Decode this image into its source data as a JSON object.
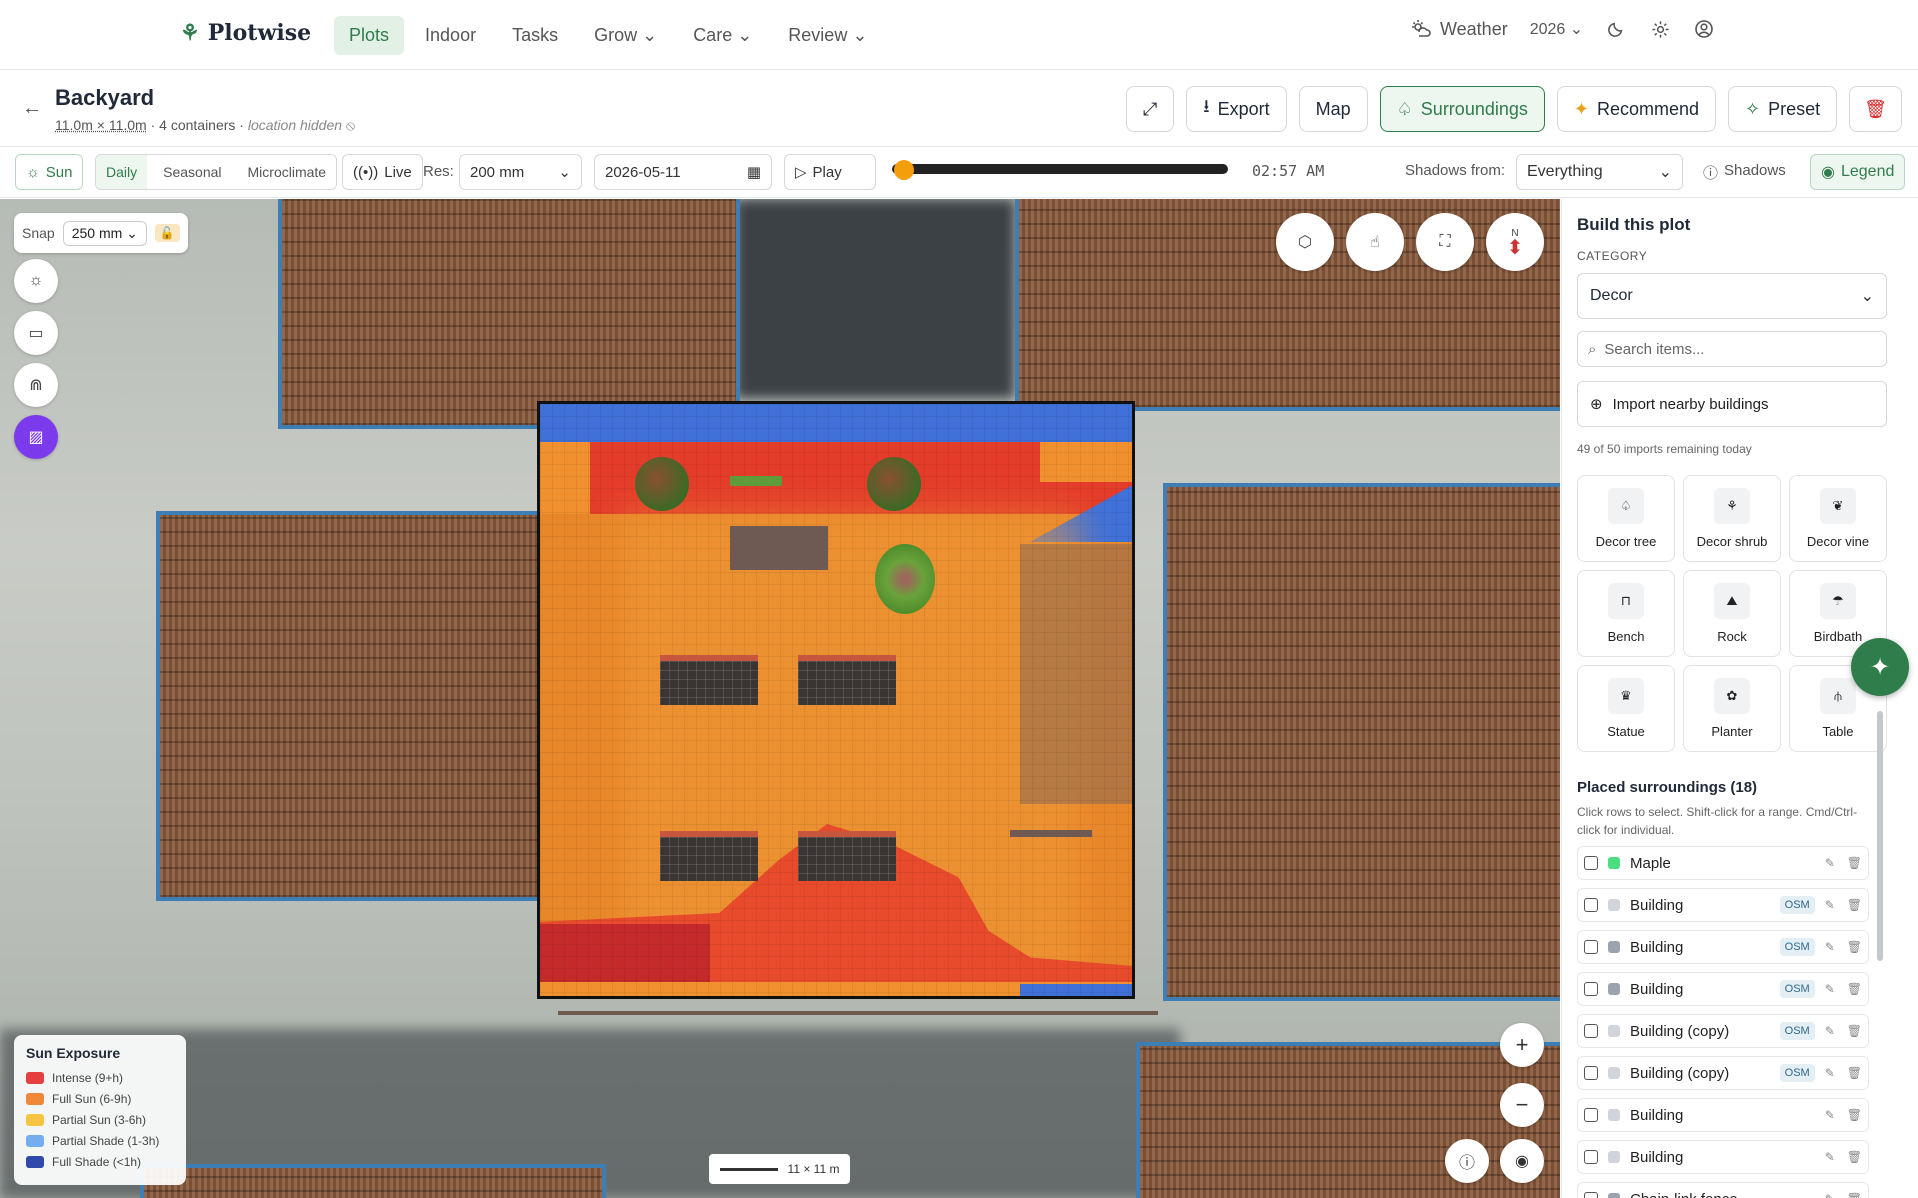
{
  "nav": {
    "brand": "Plotwise",
    "items": [
      {
        "label": "Plots",
        "active": true
      },
      {
        "label": "Indoor",
        "active": false
      },
      {
        "label": "Tasks",
        "active": false
      },
      {
        "label": "Grow ⌄",
        "active": false
      },
      {
        "label": "Care ⌄",
        "active": false
      },
      {
        "label": "Review ⌄",
        "active": false
      }
    ],
    "weather": "Weather",
    "year": "2026 ⌄"
  },
  "header": {
    "title": "Backyard",
    "dimensions": "11.0m × 11.0m",
    "containers": " · 4 containers · ",
    "location": "location hidden",
    "buttons": {
      "export": "Export",
      "map": "Map",
      "surroundings": "Surroundings",
      "recommend": "Recommend",
      "preset": "Preset"
    }
  },
  "toolbar": {
    "sun": "Sun",
    "modes": [
      "Daily",
      "Seasonal",
      "Microclimate"
    ],
    "active_mode": "Daily",
    "live": "Live",
    "res_label": "Res:",
    "res_value": "200 mm",
    "date": "2026-05-11",
    "play": "Play",
    "time": "02:57 AM",
    "time_progress": 0.02,
    "shadows_from_label": "Shadows from:",
    "shadows_from_value": "Everything",
    "shadows": "Shadows",
    "legend": "Legend"
  },
  "canvas": {
    "snap_label": "Snap",
    "snap_value": "250 mm",
    "compass": "N",
    "scale": "11 × 11 m",
    "legend": {
      "title": "Sun Exposure",
      "items": [
        {
          "label": "Intense (9+h)",
          "color": "#e53e3e"
        },
        {
          "label": "Full Sun (6-9h)",
          "color": "#f0883a"
        },
        {
          "label": "Partial Sun (3-6h)",
          "color": "#f5c542"
        },
        {
          "label": "Partial Shade (1-3h)",
          "color": "#74aef0"
        },
        {
          "label": "Full Shade (<1h)",
          "color": "#2f4aa8"
        }
      ]
    }
  },
  "panel": {
    "title": "Build this plot",
    "category_label": "CATEGORY",
    "category_value": "Decor",
    "search_placeholder": "Search items...",
    "import": "Import nearby buildings",
    "remaining": "49 of 50 imports remaining today",
    "tiles": [
      {
        "label": "Decor tree",
        "icon": "tree-icon"
      },
      {
        "label": "Decor shrub",
        "icon": "shrub-icon"
      },
      {
        "label": "Decor vine",
        "icon": "vine-icon"
      },
      {
        "label": "Bench",
        "icon": "bench-icon"
      },
      {
        "label": "Rock",
        "icon": "rock-icon"
      },
      {
        "label": "Birdbath",
        "icon": "birdbath-icon"
      },
      {
        "label": "Statue",
        "icon": "statue-icon"
      },
      {
        "label": "Planter",
        "icon": "planter-icon"
      },
      {
        "label": "Table",
        "icon": "table-icon"
      }
    ],
    "placed_title": "Placed surroundings (18)",
    "placed_help": "Click rows to select. Shift-click for a range. Cmd/Ctrl-click for individual.",
    "placed": [
      {
        "name": "Maple",
        "color": "#4ade80",
        "osm": ""
      },
      {
        "name": "Building",
        "color": "#d1d5db",
        "osm": "OSM"
      },
      {
        "name": "Building",
        "color": "#9ca3af",
        "osm": "OSM"
      },
      {
        "name": "Building",
        "color": "#9ca3af",
        "osm": "OSM"
      },
      {
        "name": "Building (copy)",
        "color": "#d1d5db",
        "osm": "OSM"
      },
      {
        "name": "Building (copy)",
        "color": "#d1d5db",
        "osm": "OSM"
      },
      {
        "name": "Building",
        "color": "#d1d5db",
        "osm": ""
      },
      {
        "name": "Building",
        "color": "#d1d5db",
        "osm": ""
      },
      {
        "name": "Chain-link fence",
        "color": "#9ca3af",
        "osm": ""
      }
    ]
  }
}
